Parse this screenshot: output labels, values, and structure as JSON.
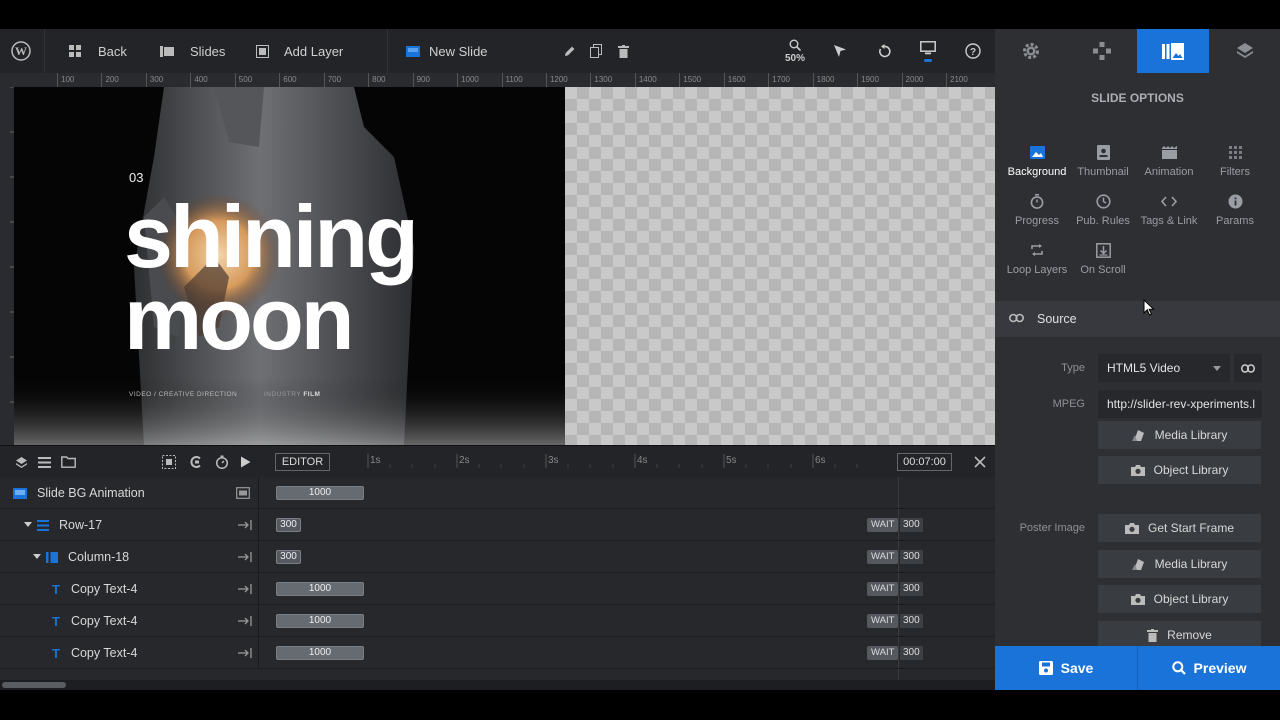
{
  "topbar": {
    "back_label": "Back",
    "slides_label": "Slides",
    "add_layer_label": "Add Layer",
    "slide_name": "New Slide",
    "zoom_label": "50%"
  },
  "ruler": {
    "labels": [
      "100",
      "200",
      "300",
      "400",
      "500",
      "600",
      "700",
      "800",
      "900",
      "1000",
      "1100",
      "1200",
      "1300",
      "1400",
      "1500",
      "1600",
      "1700",
      "1800",
      "1900",
      "2000",
      "2100"
    ]
  },
  "slide": {
    "number": "03",
    "headline_line1": "shining",
    "headline_line2": "moon",
    "caption_left": "VIDEO / CREATIVE DIRECTION",
    "caption_right_light": "INDUSTRY",
    "caption_right_bold": "FILM"
  },
  "timeline": {
    "editor_label": "EDITOR",
    "ticks": [
      "1s",
      "2s",
      "3s",
      "4s",
      "5s",
      "6s"
    ],
    "time_display": "00:07:00",
    "wait_label": "WAIT",
    "rows": [
      {
        "name": "Slide BG Animation",
        "duration": "1000",
        "wait": ""
      },
      {
        "name": "Row-17",
        "duration": "300",
        "wait": "300"
      },
      {
        "name": "Column-18",
        "duration": "300",
        "wait": "300"
      },
      {
        "name": "Copy Text-4",
        "duration": "1000",
        "wait": "300"
      },
      {
        "name": "Copy Text-4",
        "duration": "1000",
        "wait": "300"
      },
      {
        "name": "Copy Text-4",
        "duration": "1000",
        "wait": "300"
      }
    ]
  },
  "panel": {
    "title": "SLIDE OPTIONS",
    "options": [
      {
        "label": "Background",
        "icon": "image-icon",
        "active": true
      },
      {
        "label": "Thumbnail",
        "icon": "thumbnail-icon"
      },
      {
        "label": "Animation",
        "icon": "clapper-icon"
      },
      {
        "label": "Filters",
        "icon": "filters-icon"
      },
      {
        "label": "Progress",
        "icon": "stopwatch-icon"
      },
      {
        "label": "Pub. Rules",
        "icon": "clock-icon"
      },
      {
        "label": "Tags & Link",
        "icon": "code-icon"
      },
      {
        "label": "Params",
        "icon": "info-icon"
      },
      {
        "label": "Loop Layers",
        "icon": "loop-icon"
      },
      {
        "label": "On Scroll",
        "icon": "scroll-icon"
      }
    ],
    "section_title": "Source",
    "type_label": "Type",
    "type_value": "HTML5 Video",
    "mpeg_label": "MPEG",
    "mpeg_value": "http://slider-rev-xperiments.l",
    "media_library_label": "Media Library",
    "object_library_label": "Object Library",
    "poster_label": "Poster Image",
    "get_start_frame_label": "Get Start Frame",
    "remove_label": "Remove"
  },
  "footer": {
    "save_label": "Save",
    "preview_label": "Preview"
  },
  "colors": {
    "accent": "#1a73d9",
    "panel_bg": "#2d2f33",
    "timeline_bg": "#26282b"
  }
}
